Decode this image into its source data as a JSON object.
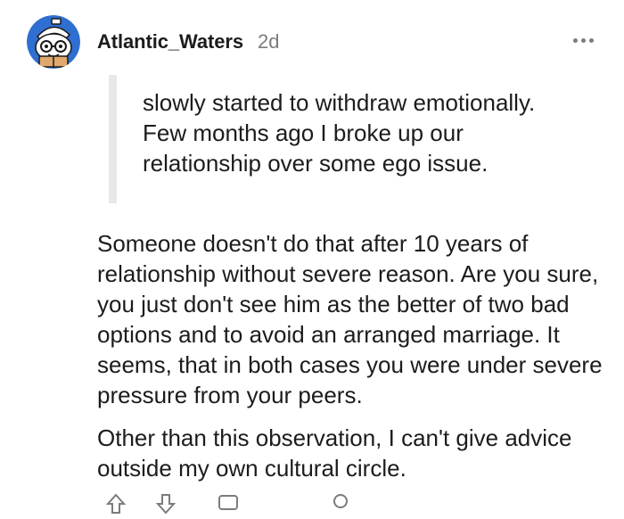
{
  "comment": {
    "author": "Atlantic_Waters",
    "time_ago": "2d",
    "avatar_icon": "snoo-avatar-icon",
    "more_icon": "more-options-icon",
    "quote": [
      "slowly started to withdraw emotionally.",
      "Few months ago I broke up our",
      "relationship over some ego issue."
    ],
    "paragraphs": [
      "Someone doesn't do that after 10 years of relationship without severe reason. Are you sure, you just don't see him as the better of two bad options and to avoid an arranged marriage. It seems, that in both cases you were under severe pressure from your peers.",
      "Other than this observation, I can't give advice outside my own cultural circle."
    ],
    "actions": [
      "upvote-icon",
      "downvote-icon",
      "reply-icon",
      "award-icon"
    ]
  },
  "colors": {
    "text": "#1c1c1c",
    "muted": "#7c7c7c",
    "quote_bar": "#e8e8e8",
    "avatar_bg": "#2f6fd1"
  }
}
